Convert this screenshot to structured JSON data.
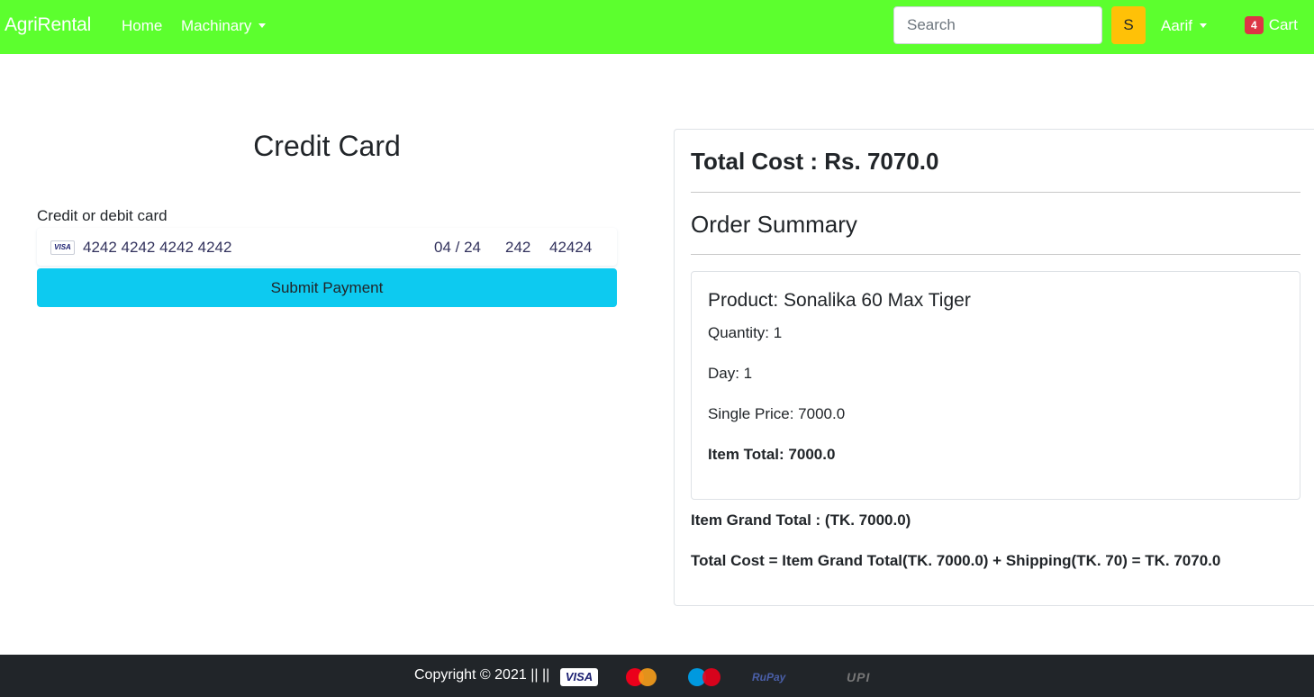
{
  "navbar": {
    "brand": "AgriRental",
    "home": "Home",
    "machinary": "Machinary",
    "search_placeholder": "Search",
    "search_button": "S",
    "user": "Aarif",
    "cart_count": "4",
    "cart_label": "Cart",
    "background": "#5cff2e"
  },
  "payment": {
    "title": "Credit Card",
    "card_label": "Credit or debit card",
    "card_brand": "VISA",
    "card_number": "4242 4242 4242 4242",
    "expiry": "04 / 24",
    "cvc": "242",
    "zip": "42424",
    "submit_label": "Submit Payment",
    "submit_color": "#0dcaf0"
  },
  "summary": {
    "total_cost": "Total Cost : Rs. 7070.0",
    "heading": "Order Summary",
    "items": [
      {
        "product": "Product: Sonalika 60 Max Tiger",
        "quantity": "Quantity: 1",
        "day": "Day: 1",
        "single_price": "Single Price: 7000.0",
        "item_total": "Item Total: 7000.0"
      }
    ],
    "grand_total": "Item Grand Total : (TK. 7000.0)",
    "calculation": "Total Cost = Item Grand Total(TK. 7000.0) + Shipping(TK. 70) = TK. 7070.0"
  },
  "footer": {
    "copyright": "Copyright © 2021 || ||",
    "payment_icons": [
      "visa-icon",
      "mastercard-icon",
      "maestro-icon",
      "rupay-icon",
      "upi-icon"
    ],
    "visa_text": "VISA",
    "rupay_text": "RuPay",
    "upi_text": "UPI"
  }
}
